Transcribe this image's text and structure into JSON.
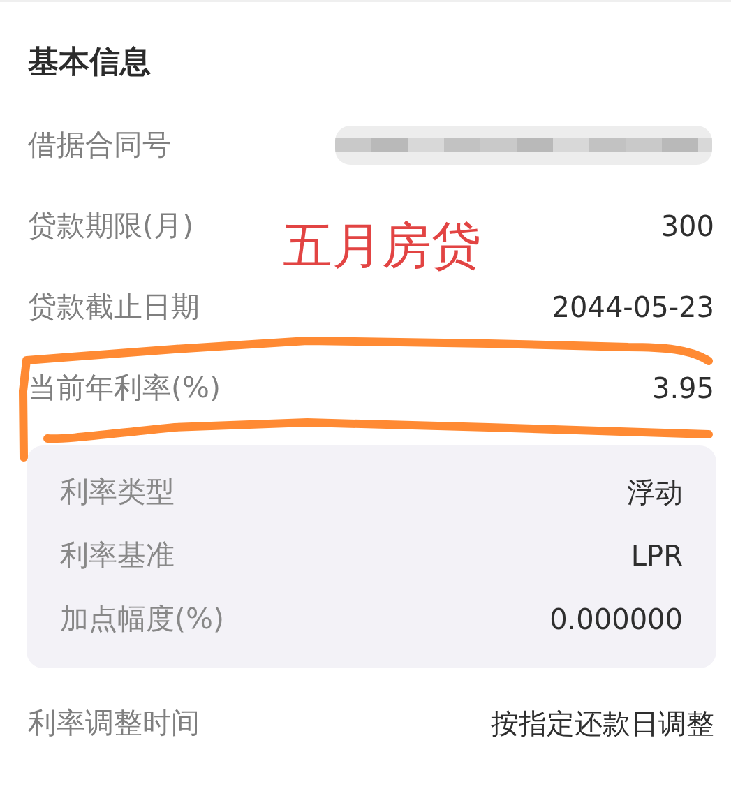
{
  "section_title": "基本信息",
  "annotation": {
    "text": "五月房贷"
  },
  "rows": [
    {
      "kind": "redacted",
      "label": "借据合同号",
      "highlighted": false
    },
    {
      "kind": "text",
      "label": "贷款期限(月)",
      "value": "300",
      "highlighted": false
    },
    {
      "kind": "text",
      "label": "贷款截止日期",
      "value": "2044-05-23",
      "highlighted": false
    },
    {
      "kind": "text",
      "label": "当前年利率(%)",
      "value": "3.95",
      "highlighted": true
    },
    {
      "kind": "panel",
      "highlighted": false,
      "items": [
        {
          "label": "利率类型",
          "value": "浮动"
        },
        {
          "label": "利率基准",
          "value": "LPR"
        },
        {
          "label": "加点幅度(%)",
          "value": "0.000000"
        }
      ]
    },
    {
      "kind": "text",
      "label": "利率调整时间",
      "value": "按指定还款日调整",
      "highlighted": false
    }
  ]
}
